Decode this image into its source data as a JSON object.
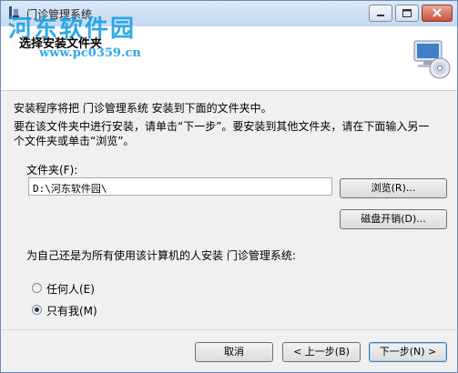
{
  "window": {
    "title": "门诊管理系统",
    "header_title": "选择安装文件夹",
    "watermark": "河东软件园",
    "watermark_url": "www.pc0359.cn"
  },
  "main": {
    "intro": "安装程序将把 门诊管理系统 安装到下面的文件夹中。",
    "instructions_line1": "要在该文件夹中进行安装，请单击“下一步”。要安装到其他文件夹，请在下面输入另一",
    "instructions_line2": "个文件夹或单击“浏览”。",
    "folder_label": "文件夹(F):",
    "folder_value": "D:\\河东软件园\\",
    "browse_label": "浏览(R)...",
    "disk_cost_label": "磁盘开销(D)...",
    "install_for_question": "为自己还是为所有使用该计算机的人安装 门诊管理系统:",
    "options": [
      {
        "label": "任何人(E)",
        "checked": false
      },
      {
        "label": "只有我(M)",
        "checked": true
      }
    ]
  },
  "footer": {
    "cancel_label": "取消",
    "back_label": "< 上一步(B)",
    "next_label": "下一步(N) >"
  },
  "colors": {
    "accent": "#1aa0e6",
    "titlebar": "#c5d9f1",
    "close_button": "#c94f3a"
  }
}
